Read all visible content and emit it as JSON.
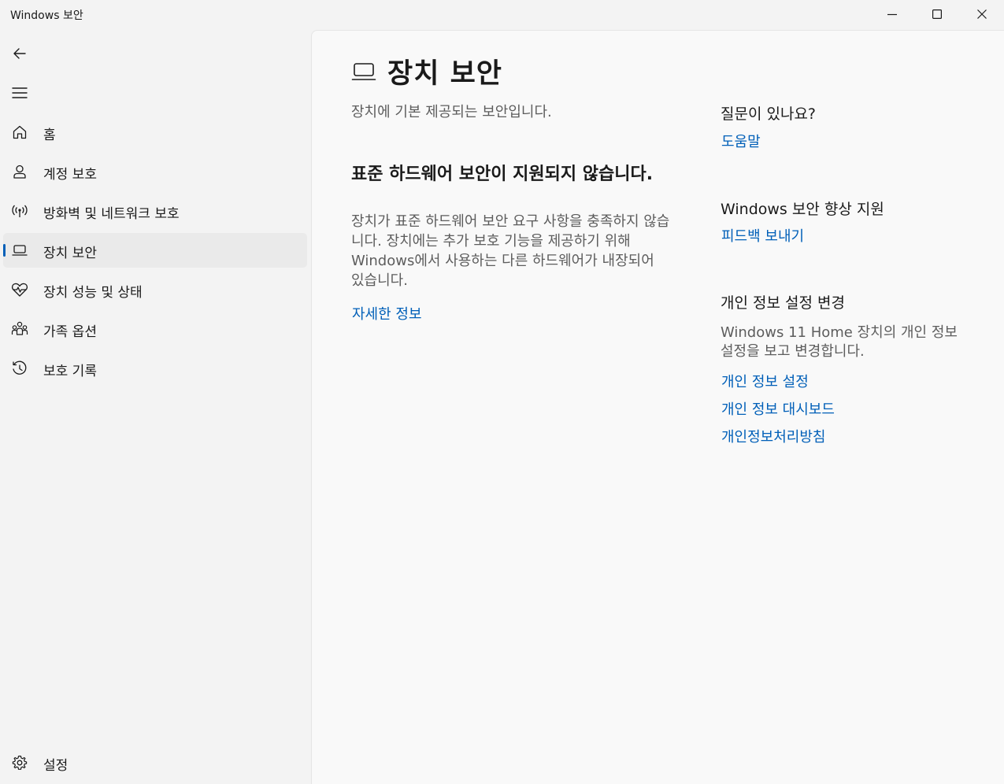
{
  "window": {
    "title": "Windows 보안"
  },
  "nav": {
    "items": [
      {
        "label": "홈",
        "icon": "home-icon"
      },
      {
        "label": "계정 보호",
        "icon": "person-icon"
      },
      {
        "label": "방화벽 및 네트워크 보호",
        "icon": "antenna-icon"
      },
      {
        "label": "장치 보안",
        "icon": "laptop-icon",
        "selected": true
      },
      {
        "label": "장치 성능 및 상태",
        "icon": "heart-pulse-icon"
      },
      {
        "label": "가족 옵션",
        "icon": "family-icon"
      },
      {
        "label": "보호 기록",
        "icon": "history-icon"
      }
    ],
    "settings_label": "설정"
  },
  "main": {
    "title": "장치 보안",
    "subtitle": "장치에 기본 제공되는 보안입니다.",
    "section_title": "표준 하드웨어 보안이 지원되지 않습니다.",
    "section_body": "장치가 표준 하드웨어 보안 요구 사항을 충족하지 않습니다. 장치에는 추가 보호 기능을 제공하기 위해 Windows에서 사용하는 다른 하드웨어가 내장되어 있습니다.",
    "learn_more": "자세한 정보"
  },
  "side": {
    "question_heading": "질문이 있나요?",
    "help_link": "도움말",
    "improve_heading": "Windows 보안 향상 지원",
    "feedback_link": "피드백 보내기",
    "privacy_heading": "개인 정보 설정 변경",
    "privacy_body": "Windows 11 Home 장치의 개인 정보 설정을 보고 변경합니다.",
    "privacy_settings_link": "개인 정보 설정",
    "privacy_dashboard_link": "개인 정보 대시보드",
    "privacy_policy_link": "개인정보처리방침"
  },
  "colors": {
    "accent": "#005fb8",
    "selected_bg": "#eaeaea",
    "content_bg": "#f9f9f9",
    "window_bg": "#f3f3f3"
  }
}
